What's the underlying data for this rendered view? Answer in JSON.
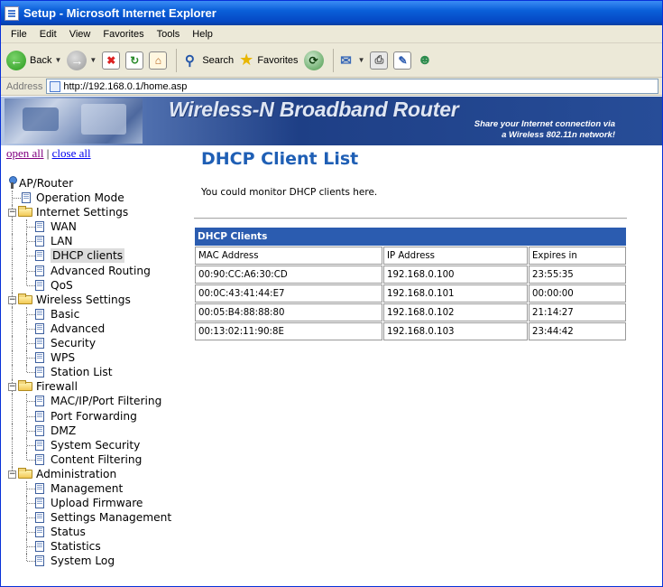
{
  "window": {
    "title": "Setup - Microsoft Internet Explorer"
  },
  "menu": [
    "File",
    "Edit",
    "View",
    "Favorites",
    "Tools",
    "Help"
  ],
  "toolbar": {
    "back_label": "Back",
    "search_label": "Search",
    "favorites_label": "Favorites"
  },
  "address": {
    "label": "Address",
    "url": "http://192.168.0.1/home.asp"
  },
  "banner": {
    "title": "Wireless-N Broadband Router",
    "tagline1": "Share your Internet connection via",
    "tagline2": "a Wireless 802.11n network!"
  },
  "tree": {
    "open_all": "open all",
    "separator": "|",
    "close_all": "close all",
    "root": "AP/Router",
    "items": [
      {
        "label": "Operation Mode",
        "level": 1,
        "type": "doc"
      },
      {
        "label": "Internet Settings",
        "level": 1,
        "type": "folder"
      },
      {
        "label": "WAN",
        "level": 2,
        "type": "doc"
      },
      {
        "label": "LAN",
        "level": 2,
        "type": "doc"
      },
      {
        "label": "DHCP clients",
        "level": 2,
        "type": "doc",
        "selected": true
      },
      {
        "label": "Advanced Routing",
        "level": 2,
        "type": "doc"
      },
      {
        "label": "QoS",
        "level": 2,
        "type": "doc"
      },
      {
        "label": "Wireless Settings",
        "level": 1,
        "type": "folder"
      },
      {
        "label": "Basic",
        "level": 2,
        "type": "doc"
      },
      {
        "label": "Advanced",
        "level": 2,
        "type": "doc"
      },
      {
        "label": "Security",
        "level": 2,
        "type": "doc"
      },
      {
        "label": "WPS",
        "level": 2,
        "type": "doc"
      },
      {
        "label": "Station List",
        "level": 2,
        "type": "doc"
      },
      {
        "label": "Firewall",
        "level": 1,
        "type": "folder"
      },
      {
        "label": "MAC/IP/Port Filtering",
        "level": 2,
        "type": "doc"
      },
      {
        "label": "Port Forwarding",
        "level": 2,
        "type": "doc"
      },
      {
        "label": "DMZ",
        "level": 2,
        "type": "doc"
      },
      {
        "label": "System Security",
        "level": 2,
        "type": "doc"
      },
      {
        "label": "Content Filtering",
        "level": 2,
        "type": "doc"
      },
      {
        "label": "Administration",
        "level": 1,
        "type": "folder"
      },
      {
        "label": "Management",
        "level": 2,
        "type": "doc"
      },
      {
        "label": "Upload Firmware",
        "level": 2,
        "type": "doc"
      },
      {
        "label": "Settings Management",
        "level": 2,
        "type": "doc"
      },
      {
        "label": "Status",
        "level": 2,
        "type": "doc"
      },
      {
        "label": "Statistics",
        "level": 2,
        "type": "doc"
      },
      {
        "label": "System Log",
        "level": 2,
        "type": "doc"
      }
    ]
  },
  "main": {
    "title": "DHCP Client List",
    "description": "You could monitor DHCP clients here.",
    "table": {
      "caption": "DHCP Clients",
      "headers": [
        "MAC Address",
        "IP Address",
        "Expires in"
      ],
      "rows": [
        [
          "00:90:CC:A6:30:CD",
          "192.168.0.100",
          "23:55:35"
        ],
        [
          "00:0C:43:41:44:E7",
          "192.168.0.101",
          "00:00:00"
        ],
        [
          "00:05:B4:88:88:80",
          "192.168.0.102",
          "21:14:27"
        ],
        [
          "00:13:02:11:90:8E",
          "192.168.0.103",
          "23:44:42"
        ]
      ]
    }
  },
  "colors": {
    "title_blue": "#1f5fb5",
    "table_header": "#2b5cb0",
    "xp_blue": "#0a5fd8"
  }
}
